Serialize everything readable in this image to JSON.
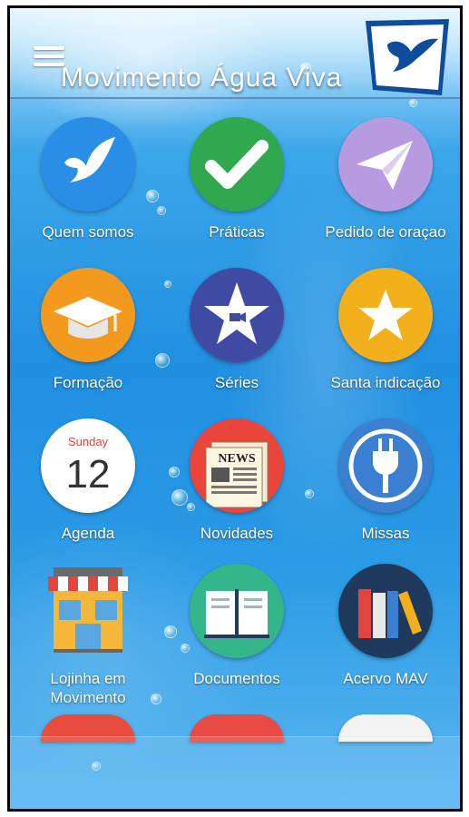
{
  "header": {
    "title": "Movimento Água Viva",
    "menu_icon": "hamburger-menu-icon",
    "logo_icon": "dove-logo-icon"
  },
  "tiles": [
    {
      "label": "Quem somos",
      "icon": "dove-icon",
      "color": "#2b8ee6"
    },
    {
      "label": "Práticas",
      "icon": "checkmark-icon",
      "color": "#2fa84f"
    },
    {
      "label": "Pedido de oraçao",
      "icon": "paper-plane-icon",
      "color": "#b79be0"
    },
    {
      "label": "Formação",
      "icon": "graduation-cap-icon",
      "color": "#f39a1e"
    },
    {
      "label": "Séries",
      "icon": "star-video-icon",
      "color": "#3f4aa3"
    },
    {
      "label": "Santa indicação",
      "icon": "star-icon",
      "color": "#f2b01c"
    },
    {
      "label": "Agenda",
      "icon": "calendar-icon",
      "color": "#ffffff",
      "calendar_day": "Sunday",
      "calendar_date": "12"
    },
    {
      "label": "Novidades",
      "icon": "newspaper-icon",
      "color": "#e9453b",
      "newspaper_text": "NEWS"
    },
    {
      "label": "Missas",
      "icon": "power-plug-icon",
      "color": "#3a7fd0"
    },
    {
      "label": "Lojinha em Movimento",
      "icon": "shop-icon",
      "color": "#ffffff"
    },
    {
      "label": "Documentos",
      "icon": "open-book-icon",
      "color": "#35b58a"
    },
    {
      "label": "Acervo MAV",
      "icon": "books-icon",
      "color": "#1f3a5c"
    }
  ]
}
